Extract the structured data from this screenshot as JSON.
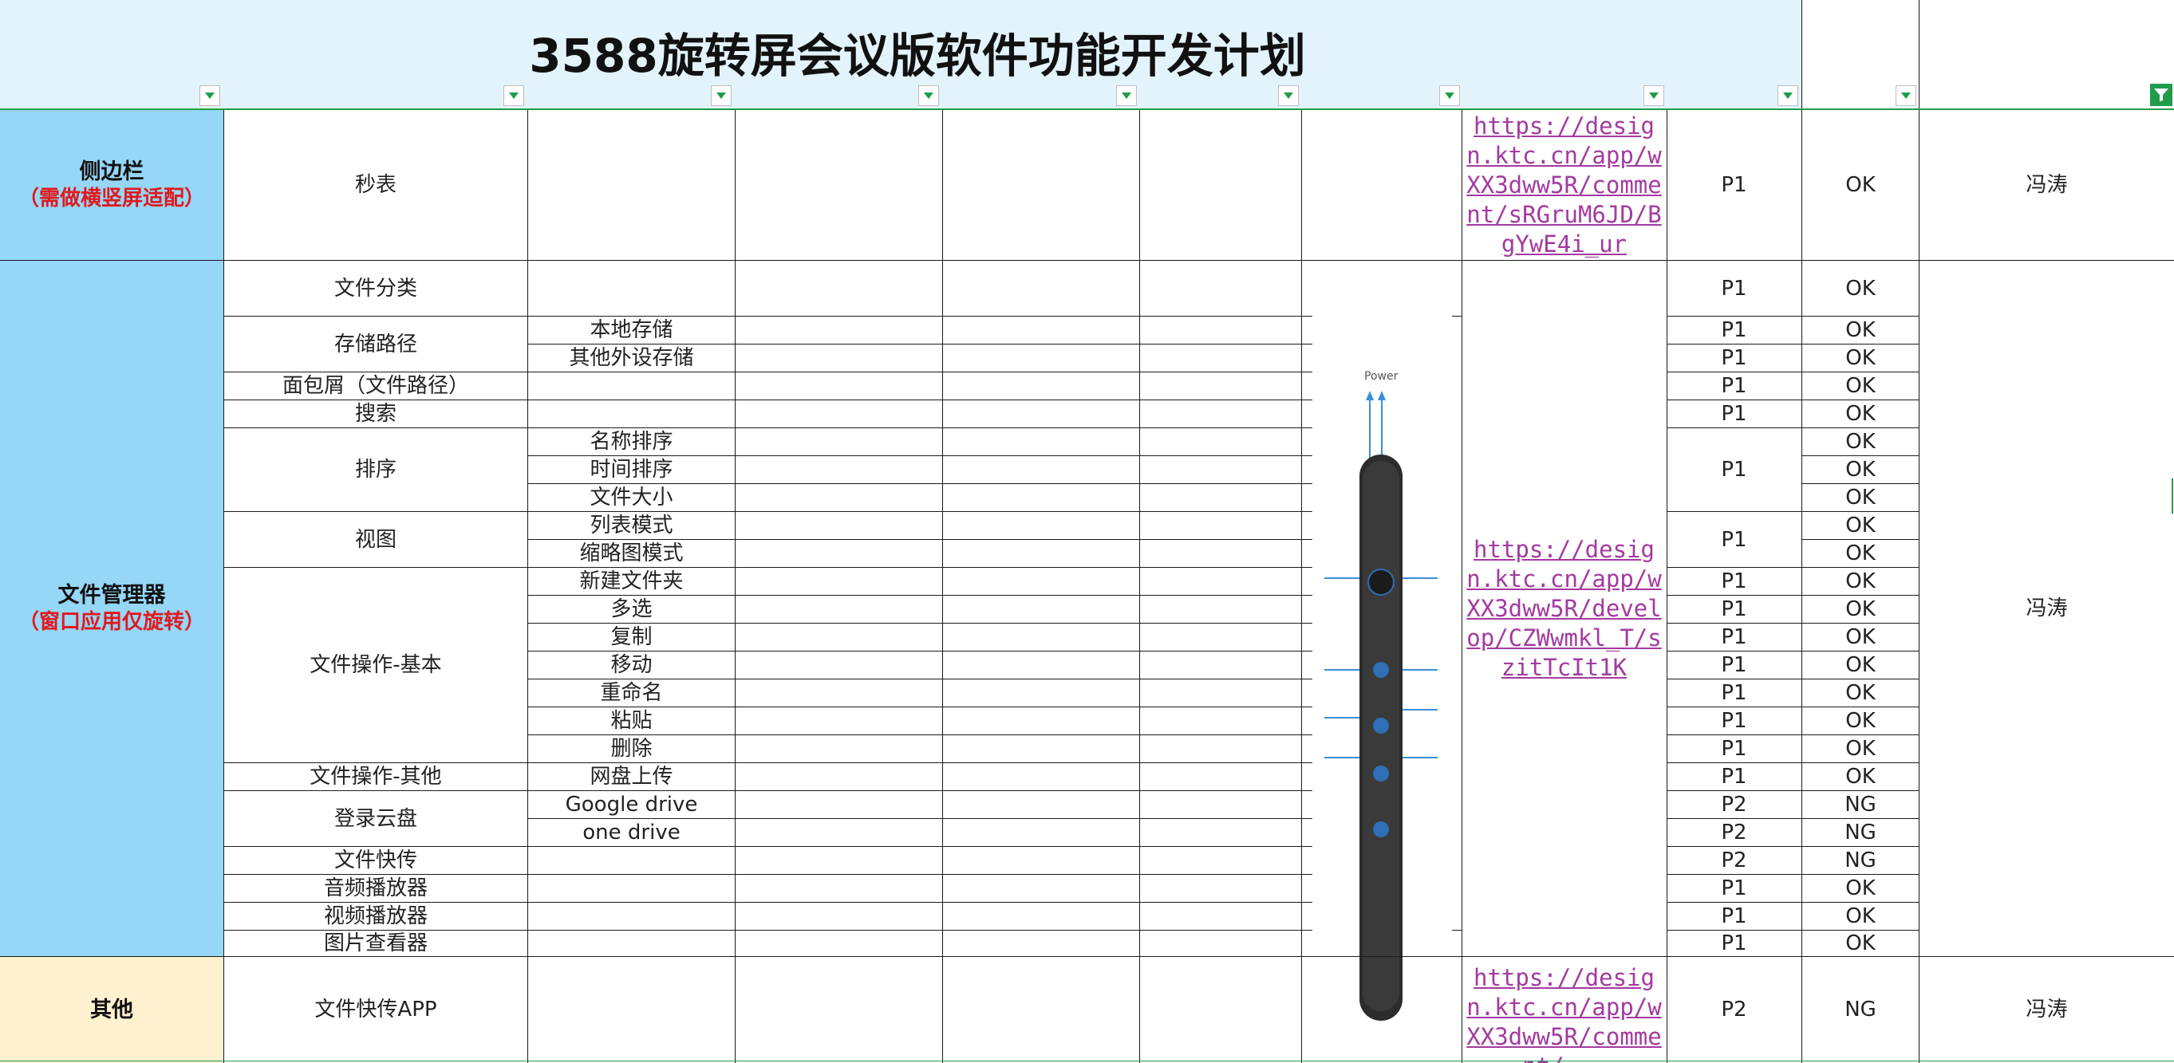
{
  "sheet": {
    "title": "3588旋转屏会议版软件功能开发计划",
    "sections": {
      "sidebar": {
        "name": "侧边栏",
        "note": "（需做横竖屏适配）"
      },
      "file_manager": {
        "name": "文件管理器",
        "note": "（窗口应用仅旋转）"
      },
      "other": {
        "name": "其他",
        "note": ""
      }
    },
    "features": [
      "秒表",
      "文件分类",
      "存储路径",
      "面包屑（文件路径）",
      "搜索",
      "排序",
      "视图",
      "文件操作-基本",
      "文件操作-其他",
      "登录云盘",
      "文件快传",
      "音频播放器",
      "视频播放器",
      "图片查看器",
      "文件快传APP"
    ],
    "subfeatures": [
      "本地存储",
      "其他外设存储",
      "名称排序",
      "时间排序",
      "文件大小",
      "列表模式",
      "缩略图模式",
      "新建文件夹",
      "多选",
      "复制",
      "移动",
      "重命名",
      "粘贴",
      "删除",
      "网盘上传",
      "Google drive",
      "one drive"
    ],
    "links": [
      "https://design.ktc.cn/app/wXX3dww5R/comment/sRGruM6JD/BgYwE4i_ur",
      "https://design.ktc.cn/app/wXX3dww5R/develop/CZWwmkl_T/szitTcIt1K",
      "https://design.ktc.cn/app/wXX3dww5R/comment/..."
    ],
    "priority": [
      "P1",
      "P1",
      "P1",
      "P1",
      "P1",
      "P1",
      "P1",
      "P1",
      "P1",
      "P1",
      "P1",
      "P1",
      "P1",
      "P1",
      "P1",
      "P1",
      "P2",
      "P2",
      "P2",
      "P1",
      "P1",
      "P1",
      "P2"
    ],
    "status": [
      "OK",
      "OK",
      "OK",
      "OK",
      "OK",
      "OK",
      "OK",
      "OK",
      "OK",
      "OK",
      "OK",
      "OK",
      "OK",
      "OK",
      "OK",
      "OK",
      "OK",
      "OK",
      "OK",
      "NG",
      "NG",
      "NG",
      "OK",
      "OK",
      "OK",
      "NG"
    ],
    "owners": [
      "冯涛",
      "冯涛",
      "冯涛"
    ],
    "colors": {
      "header_bg": "#e3f3fc",
      "sidebar_bg": "#96d6f6",
      "other_bg": "#fdf1d0",
      "accent_red": "#e0191d",
      "link": "#a33aa0",
      "filter_green": "#1f9d4a"
    }
  }
}
